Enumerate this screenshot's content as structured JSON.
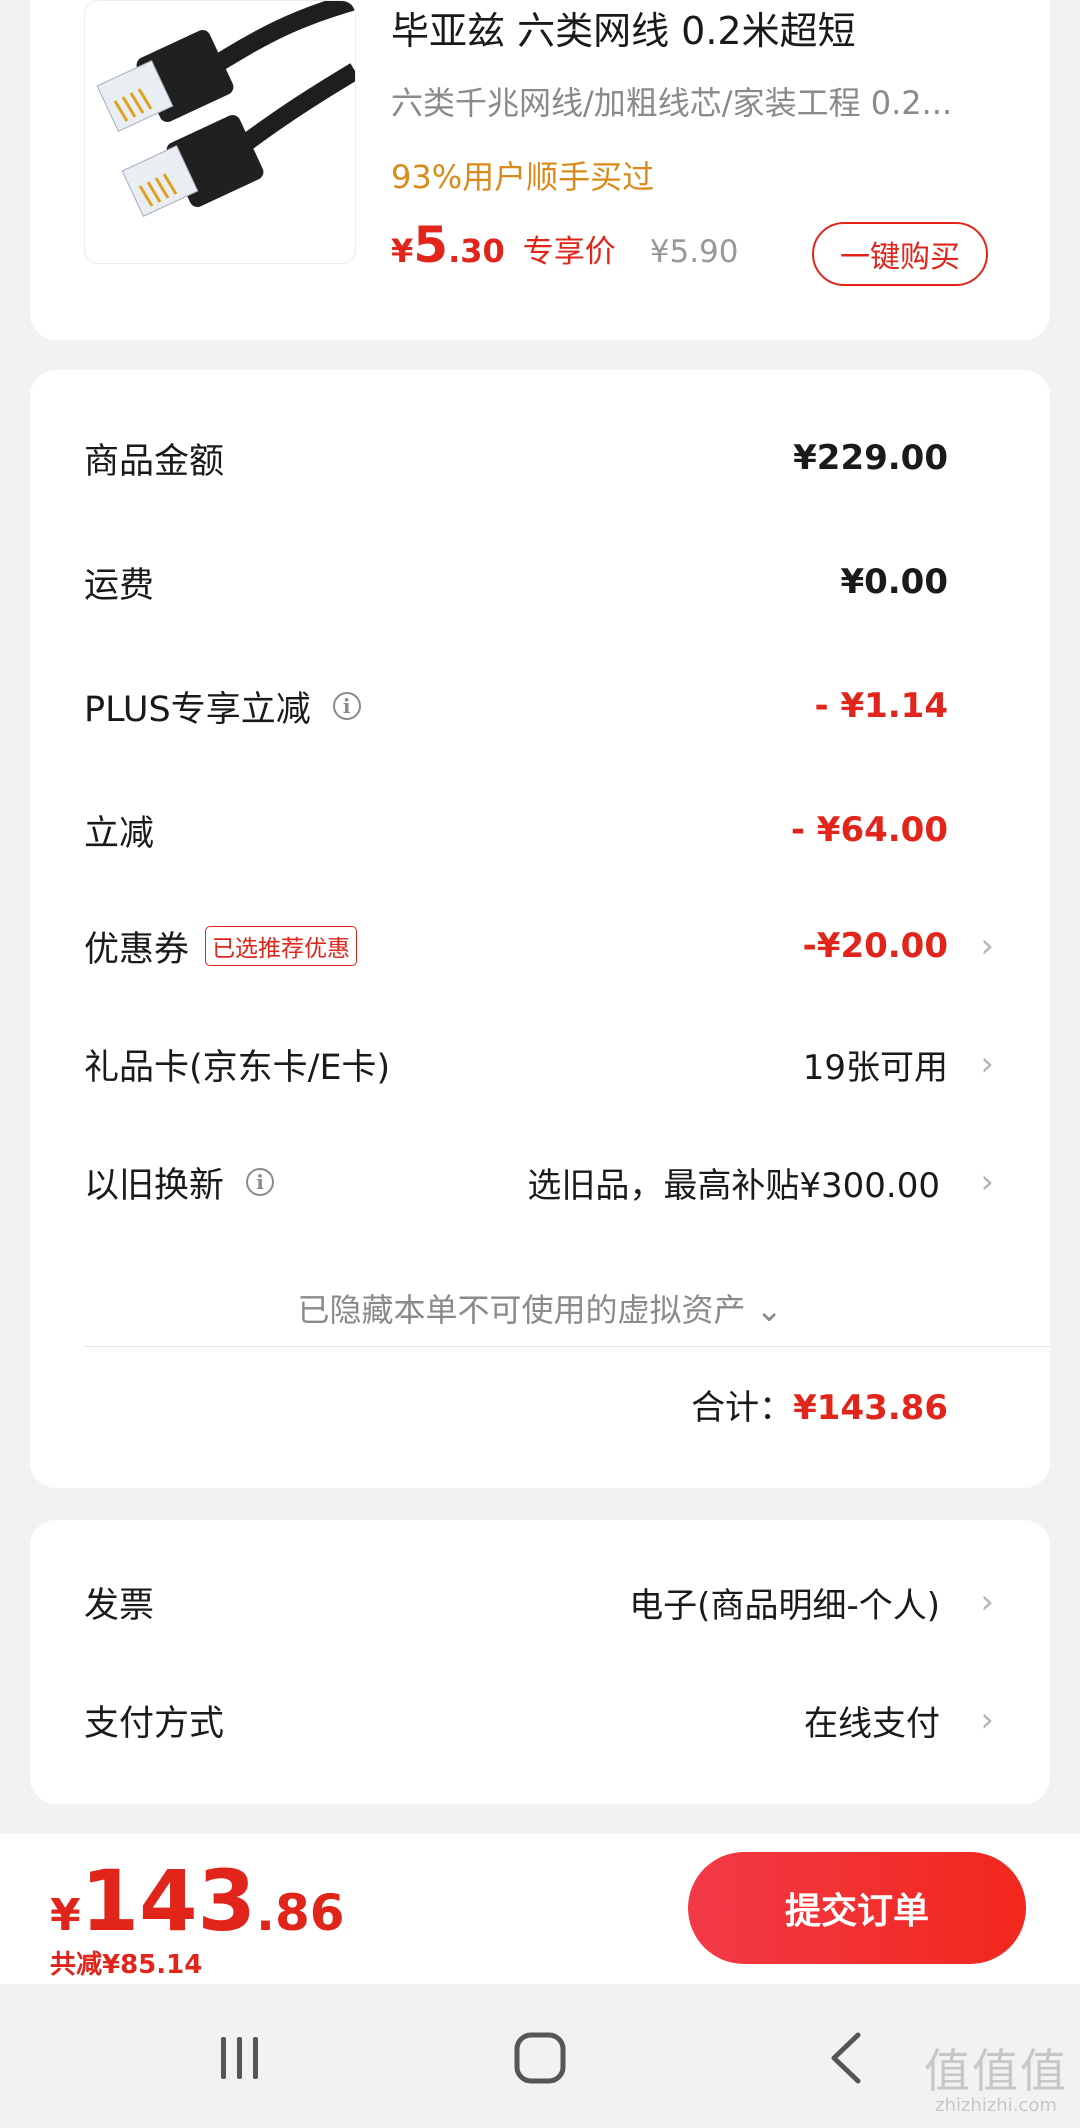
{
  "product": {
    "title": "毕亚兹 六类网线 0.2米超短",
    "spec": "六类千兆网线/加粗线芯/家装工程   0.2...",
    "hint": "93%用户顺手买过",
    "price_symbol": "¥",
    "price_int": "5",
    "price_dec": ".30",
    "price_tag": "专享价",
    "original_price": "¥5.90",
    "buy_button": "一键购买"
  },
  "cost": {
    "rows": [
      {
        "label": "商品金额",
        "value": "¥229.00"
      },
      {
        "label": "运费",
        "value": "¥0.00"
      },
      {
        "label": "PLUS专享立减",
        "value": "- ¥1.14"
      },
      {
        "label": "立减",
        "value": "- ¥64.00"
      },
      {
        "label": "优惠券",
        "tag": "已选推荐优惠",
        "value": "-¥20.00"
      },
      {
        "label": "礼品卡(京东卡/E卡)",
        "value": "19张可用"
      },
      {
        "label": "以旧换新",
        "value": "选旧品，最高补贴¥300.00"
      }
    ],
    "hidden_note": "已隐藏本单不可使用的虚拟资产",
    "total_label": "合计：",
    "total_value": "¥143.86"
  },
  "invoice": {
    "rows": [
      {
        "label": "发票",
        "value": "电子(商品明细-个人)"
      },
      {
        "label": "支付方式",
        "value": "在线支付"
      }
    ]
  },
  "bottom": {
    "symbol": "¥",
    "total_int": "143",
    "total_dec": ".86",
    "saving": "共减¥85.14",
    "submit": "提交订单"
  },
  "watermark": {
    "main": "值值值",
    "sub": "zhizhizhi.com"
  },
  "icons": [
    "info-icon",
    "chevron-right-icon",
    "chevron-down-icon",
    "recents-icon",
    "home-icon",
    "back-icon"
  ],
  "colors": {
    "accent": "#e1251b",
    "hint": "#d98a1a",
    "background": "#f2f2f2"
  }
}
